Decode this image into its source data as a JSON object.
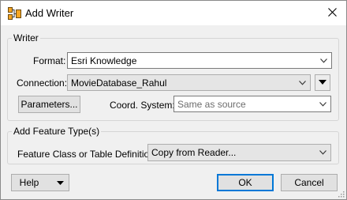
{
  "window": {
    "title": "Add Writer",
    "icon": "fme-workspace-icon"
  },
  "writer_group": {
    "legend": "Writer",
    "format_label": "Format:",
    "format_value": "Esri Knowledge",
    "connection_label": "Connection:",
    "connection_value": "MovieDatabase_Rahul",
    "parameters_button": "Parameters...",
    "coord_label": "Coord. System:",
    "coord_value": "Same as source"
  },
  "feature_group": {
    "legend": "Add Feature Type(s)",
    "definition_label": "Feature Class or Table Definition:",
    "definition_value": "Copy from Reader..."
  },
  "buttons": {
    "help": "Help",
    "ok": "OK",
    "cancel": "Cancel"
  },
  "colors": {
    "default_button_border": "#0078d7",
    "title_bar": "#ffffff",
    "dialog_bg": "#f0f0f0"
  }
}
